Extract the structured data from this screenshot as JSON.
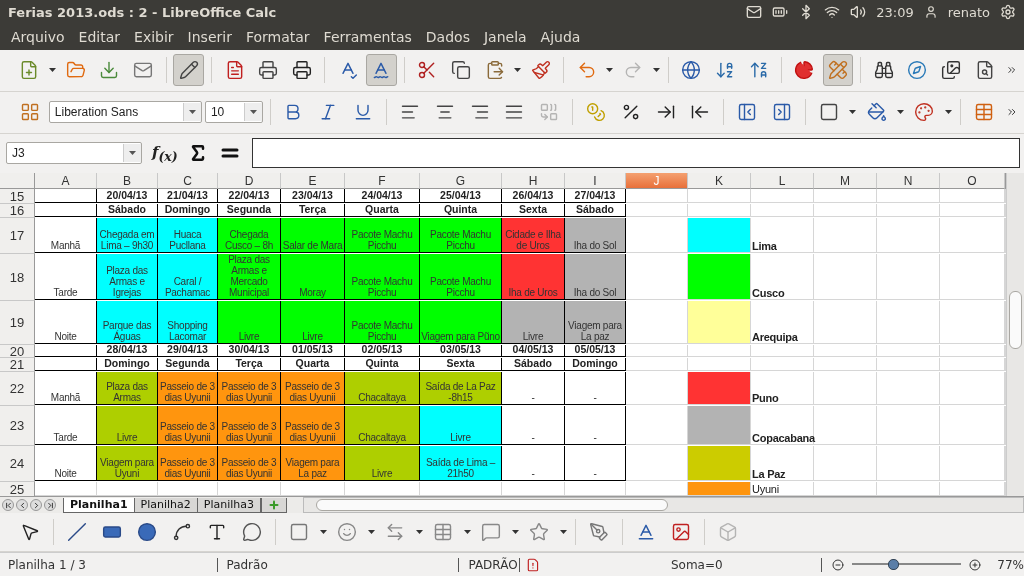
{
  "window": {
    "title": "Ferias 2013.ods : 2 - LibreOffice Calc"
  },
  "system_tray": {
    "time": "23:09",
    "user": "renato"
  },
  "menu": [
    "Arquivo",
    "Editar",
    "Exibir",
    "Inserir",
    "Formatar",
    "Ferramentas",
    "Dados",
    "Janela",
    "Ajuda"
  ],
  "standard_toolbar": {
    "edit_mode_on": true,
    "auto_spellcheck_on": true,
    "redo_disabled": true,
    "draw_functions_on": true
  },
  "formatting_toolbar": {
    "font_name": "Liberation Sans",
    "font_size": "10",
    "merge_disabled": true
  },
  "formula_bar": {
    "name_box": "J3",
    "function_wizard": "f$_{(x)}$"
  },
  "columns": [
    {
      "label": "A",
      "selected": false
    },
    {
      "label": "B",
      "selected": false
    },
    {
      "label": "C",
      "selected": false
    },
    {
      "label": "D",
      "selected": false
    },
    {
      "label": "E",
      "selected": false
    },
    {
      "label": "F",
      "selected": false
    },
    {
      "label": "G",
      "selected": false
    },
    {
      "label": "H",
      "selected": false
    },
    {
      "label": "I",
      "selected": false
    },
    {
      "label": "J",
      "selected": true
    },
    {
      "label": "K",
      "selected": false
    },
    {
      "label": "L",
      "selected": false
    },
    {
      "label": "M",
      "selected": false
    },
    {
      "label": "N",
      "selected": false
    },
    {
      "label": "O",
      "selected": false
    }
  ],
  "rows": [
    {
      "number": "15",
      "kind": "date",
      "cells": [
        {},
        {
          "text": "20/04/13"
        },
        {
          "text": "21/04/13"
        },
        {
          "text": "22/04/13"
        },
        {
          "text": "23/04/13"
        },
        {
          "text": "24/04/13"
        },
        {
          "text": "25/04/13"
        },
        {
          "text": "26/04/13"
        },
        {
          "text": "27/04/13"
        }
      ]
    },
    {
      "number": "16",
      "kind": "date",
      "cells": [
        {},
        {
          "text": "Sábado"
        },
        {
          "text": "Domingo"
        },
        {
          "text": "Segunda"
        },
        {
          "text": "Terça"
        },
        {
          "text": "Quarta"
        },
        {
          "text": "Quinta"
        },
        {
          "text": "Sexta"
        },
        {
          "text": "Sábado"
        }
      ]
    },
    {
      "number": "17",
      "kind": "slot",
      "cells": [
        {
          "text": "Manhã"
        },
        {
          "text": "Chegada em Lima – 9h30",
          "color": "#00ffff"
        },
        {
          "text": "Huaca Pucllana",
          "color": "#00ffff"
        },
        {
          "text": "Chegada Cusco – 8h",
          "color": "#00ff00"
        },
        {
          "text": "Salar de Mara",
          "color": "#00ff00"
        },
        {
          "text": "Pacote Machu Picchu",
          "color": "#00ff00"
        },
        {
          "text": "Pacote Machu Picchu",
          "color": "#00ff00"
        },
        {
          "text": "Cidade e Ilha de Uros",
          "color": "#ff3333"
        },
        {
          "text": "Iha do Sol",
          "color": "#b3b3b3"
        },
        {},
        {
          "color": "#00ffff"
        },
        {
          "text": "Lima",
          "kind": "legend"
        }
      ]
    },
    {
      "number": "18",
      "kind": "slot",
      "cells": [
        {
          "text": "Tarde"
        },
        {
          "text": "Plaza das Armas e Igrejas",
          "color": "#00ffff"
        },
        {
          "text": "Caral / Pachamac",
          "color": "#00ffff"
        },
        {
          "text": "Plaza das Armas e Mercado Municipal",
          "color": "#00ff00"
        },
        {
          "text": "Moray",
          "color": "#00ff00"
        },
        {
          "text": "Pacote Machu Picchu",
          "color": "#00ff00"
        },
        {
          "text": "Pacote Machu Picchu",
          "color": "#00ff00"
        },
        {
          "text": "Iha de Uros",
          "color": "#ff3333"
        },
        {
          "text": "Iha do Sol",
          "color": "#b3b3b3"
        },
        {},
        {
          "color": "#00ff00"
        },
        {
          "text": "Cusco",
          "kind": "legend"
        }
      ]
    },
    {
      "number": "19",
      "kind": "slot",
      "cells": [
        {
          "text": "Noite"
        },
        {
          "text": "Parque das Águas",
          "color": "#00ffff"
        },
        {
          "text": "Shopping Lacomar",
          "color": "#00ffff"
        },
        {
          "text": "Livre",
          "color": "#00ff00"
        },
        {
          "text": "Livre",
          "color": "#00ff00"
        },
        {
          "text": "Pacote Machu Picchu",
          "color": "#00ff00"
        },
        {
          "text": "Viagem para Pũno",
          "color": "#00ff00"
        },
        {
          "text": "Livre",
          "color": "#b3b3b3"
        },
        {
          "text": "Viagem para La paz",
          "color": "#b3b3b3"
        },
        {},
        {
          "color": "#ffff99"
        },
        {
          "text": "Arequipa",
          "kind": "legend"
        }
      ]
    },
    {
      "number": "20",
      "kind": "date",
      "cells": [
        {},
        {
          "text": "28/04/13"
        },
        {
          "text": "29/04/13"
        },
        {
          "text": "30/04/13"
        },
        {
          "text": "01/05/13"
        },
        {
          "text": "02/05/13"
        },
        {
          "text": "03/05/13"
        },
        {
          "text": "04/05/13"
        },
        {
          "text": "05/05/13"
        }
      ]
    },
    {
      "number": "21",
      "kind": "date",
      "cells": [
        {},
        {
          "text": "Domingo"
        },
        {
          "text": "Segunda"
        },
        {
          "text": "Terça"
        },
        {
          "text": "Quarta"
        },
        {
          "text": "Quinta"
        },
        {
          "text": "Sexta"
        },
        {
          "text": "Sábado"
        },
        {
          "text": "Domingo"
        }
      ]
    },
    {
      "number": "22",
      "kind": "slot",
      "cells": [
        {
          "text": "Manhã"
        },
        {
          "text": "Plaza das Armas",
          "color": "#aecf00"
        },
        {
          "text": "Passeio de 3 dias Uyunii",
          "color": "#ff950e"
        },
        {
          "text": "Passeio de 3 dias Uyunii",
          "color": "#ff950e"
        },
        {
          "text": "Passeio de 3 dias Uyunii",
          "color": "#ff950e"
        },
        {
          "text": "Chacaltaya",
          "color": "#aecf00"
        },
        {
          "text": "Saída de La Paz -8h15",
          "color": "#aecf00"
        },
        {
          "text": "-"
        },
        {
          "text": "-"
        },
        {},
        {
          "color": "#ff3333"
        },
        {
          "text": "Puno",
          "kind": "legend"
        }
      ]
    },
    {
      "number": "23",
      "kind": "slot",
      "cells": [
        {
          "text": "Tarde"
        },
        {
          "text": "Livre",
          "color": "#aecf00"
        },
        {
          "text": "Passeio de 3 dias Uyunii",
          "color": "#ff950e"
        },
        {
          "text": "Passeio de 3 dias Uyunii",
          "color": "#ff950e"
        },
        {
          "text": "Passeio de 3 dias Uyunii",
          "color": "#ff950e"
        },
        {
          "text": "Chacaltaya",
          "color": "#aecf00"
        },
        {
          "text": "Livre",
          "color": "#00ffff"
        },
        {
          "text": "-"
        },
        {
          "text": "-"
        },
        {},
        {
          "color": "#b3b3b3"
        },
        {
          "text": "Copacabana",
          "kind": "legend"
        }
      ]
    },
    {
      "number": "24",
      "kind": "slot",
      "cells": [
        {
          "text": "Noite"
        },
        {
          "text": "Viagem para Uyuni",
          "color": "#aecf00"
        },
        {
          "text": "Passeio de 3 dias Uyunii",
          "color": "#ff950e"
        },
        {
          "text": "Passeio de 3 dias Uyunii",
          "color": "#ff950e"
        },
        {
          "text": "Viagem para La paz",
          "color": "#ff950e"
        },
        {
          "text": "Livre",
          "color": "#aecf00"
        },
        {
          "text": "Saída de Lima – 21h50",
          "color": "#00ffff"
        },
        {
          "text": "-"
        },
        {
          "text": "-"
        },
        {},
        {
          "color": "#cccc00"
        },
        {
          "text": "La Paz",
          "kind": "legend"
        }
      ]
    },
    {
      "number": "25",
      "kind": "blank",
      "cells": [
        {},
        {},
        {},
        {},
        {},
        {},
        {},
        {},
        {},
        {},
        {
          "color": "#ff950e"
        },
        {
          "text": "Uyuni",
          "kind": "legend_plain"
        }
      ]
    }
  ],
  "sheet_tabs": [
    {
      "label": "Planilha1",
      "selected": true
    },
    {
      "label": "Planilha2",
      "selected": false
    },
    {
      "label": "Planilha3",
      "selected": false
    }
  ],
  "drawing_toolbar": {
    "extrusion_disabled": true
  },
  "status_bar": {
    "sheet": "Planilha 1 / 3",
    "page_style": "Padrão",
    "selection_mode": "PADRÃO",
    "sum": "Soma=0",
    "zoom": {
      "level": 0.37,
      "reading": "77%"
    }
  }
}
